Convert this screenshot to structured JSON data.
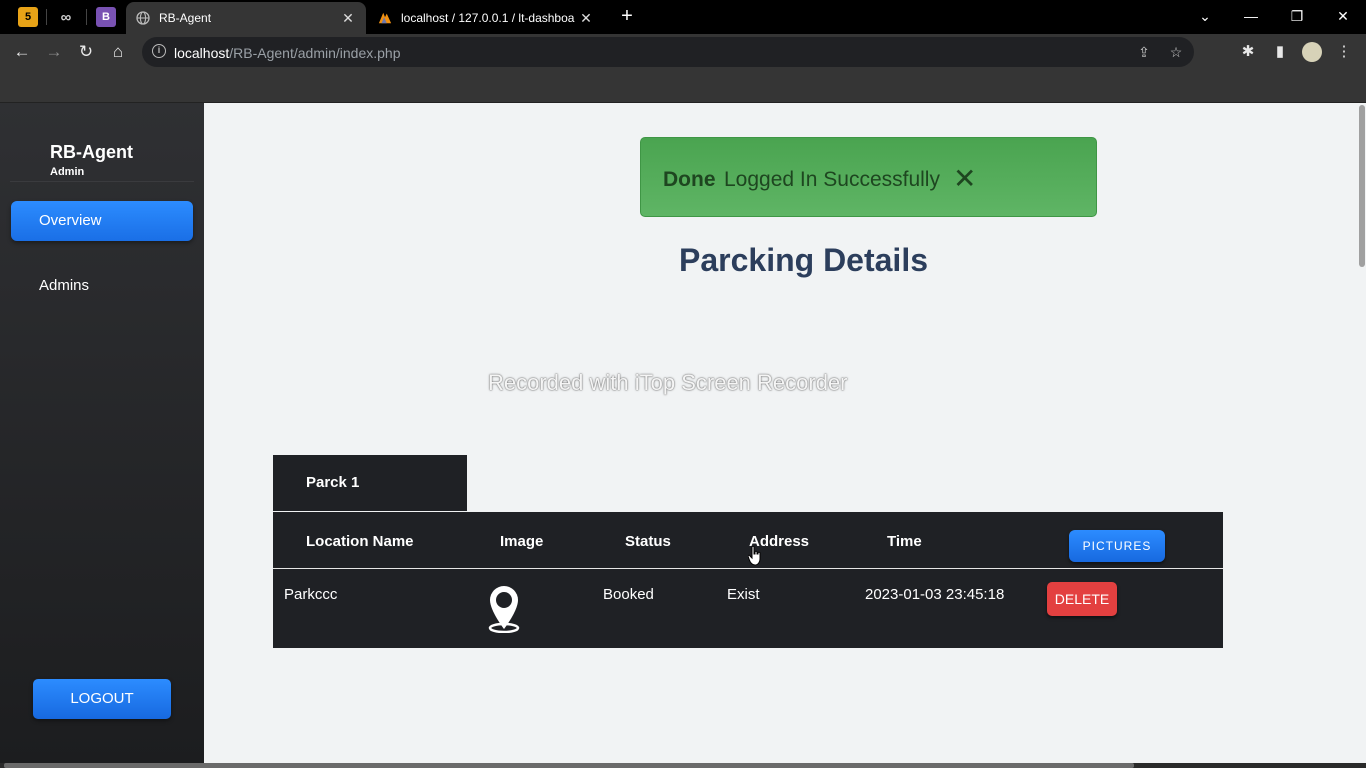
{
  "browser": {
    "pinned_tabs": [
      {
        "icon": "html5-icon",
        "glyph": "5",
        "color": "#e8a317"
      },
      {
        "icon": "infinity-icon",
        "glyph": "∞",
        "color": "#cfcfcf"
      },
      {
        "icon": "bootstrap-icon",
        "glyph": "B",
        "color": "#7952b3"
      }
    ],
    "tabs": [
      {
        "title": "RB-Agent",
        "active": true
      },
      {
        "title": "localhost / 127.0.0.1 / lt-dashboa",
        "active": false
      }
    ],
    "url_host": "localhost",
    "url_path": "/RB-Agent/admin/index.php"
  },
  "sidebar": {
    "brand": "RB-Agent",
    "role": "Admin",
    "items": [
      {
        "label": "Overview",
        "active": true
      },
      {
        "label": "Admins",
        "active": false
      }
    ],
    "logout_label": "LOGOUT"
  },
  "alert": {
    "strong": "Done",
    "message": "Logged In Successfully",
    "close": "✕",
    "color": "#4caf50"
  },
  "main": {
    "heading": "Parcking Details",
    "watermark": "Recorded with iTop Screen Recorder",
    "parck_tab": "Parck 1",
    "table": {
      "headers": [
        "Location Name",
        "Image",
        "Status",
        "Address",
        "Time"
      ],
      "pictures_label": "PICTURES",
      "rows": [
        {
          "location": "Parkccc",
          "image": "location-pin-icon",
          "status": "Booked",
          "address": "Exist",
          "time": "2023-01-03 23:45:18",
          "delete_label": "DELETE"
        }
      ]
    }
  },
  "colors": {
    "primary": "#1a73e8",
    "danger": "#e34040",
    "sidebar": "#26272a",
    "table_bg": "#1f2125"
  }
}
